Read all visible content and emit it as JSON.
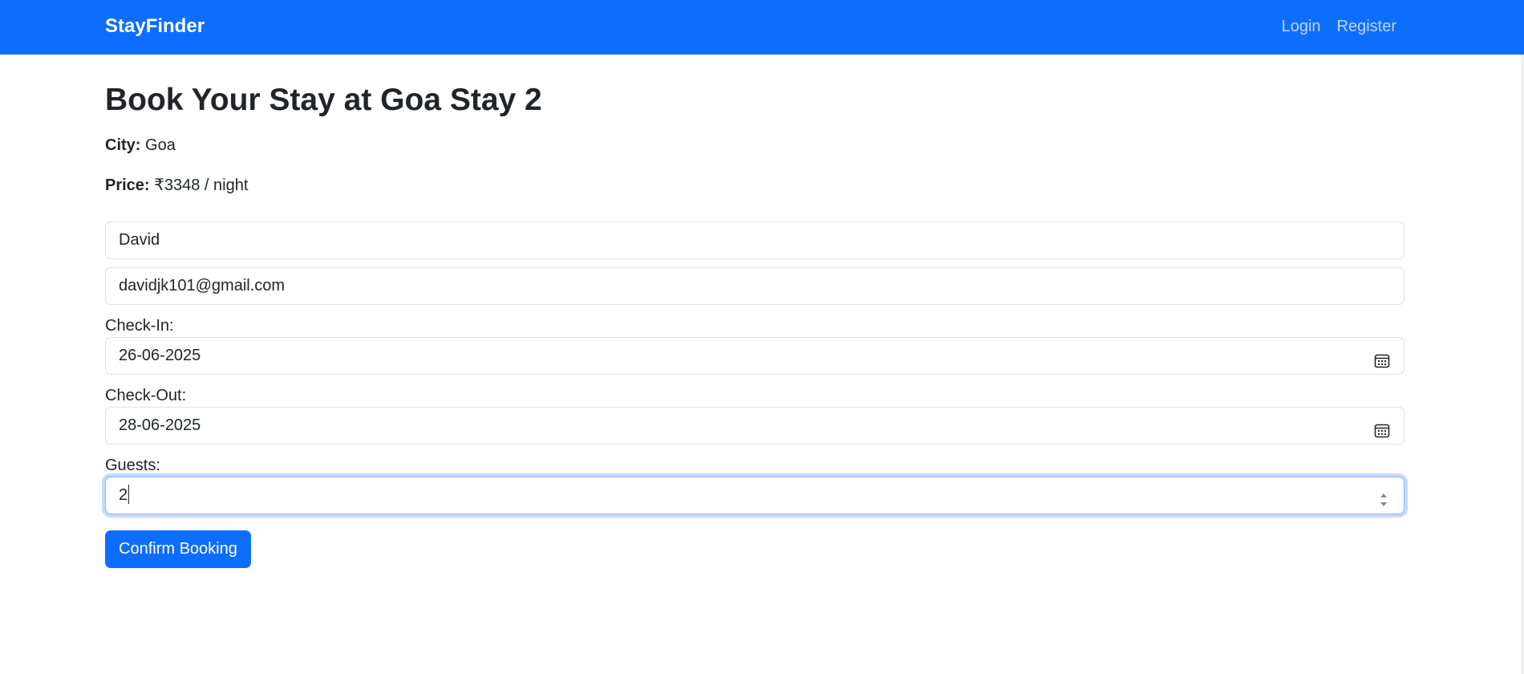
{
  "navbar": {
    "brand": "StayFinder",
    "links": [
      "Login",
      "Register"
    ]
  },
  "page": {
    "title": "Book Your Stay at Goa Stay 2",
    "city_label": "City:",
    "city_value": "Goa",
    "price_label": "Price:",
    "price_value": "₹3348 / night"
  },
  "form": {
    "name_value": "David",
    "email_value": "davidjk101@gmail.com",
    "checkin_label": "Check-In:",
    "checkin_value": "26-06-2025",
    "checkout_label": "Check-Out:",
    "checkout_value": "28-06-2025",
    "guests_label": "Guests:",
    "guests_value": "2",
    "submit_label": "Confirm Booking"
  },
  "icons": {
    "date_picker": "calendar-icon",
    "number_spinner": "spinner-arrows-icon"
  },
  "colors": {
    "primary": "#0d6efd",
    "text": "#212529",
    "border": "#dee2e6",
    "focus_border": "#86b7fe"
  }
}
